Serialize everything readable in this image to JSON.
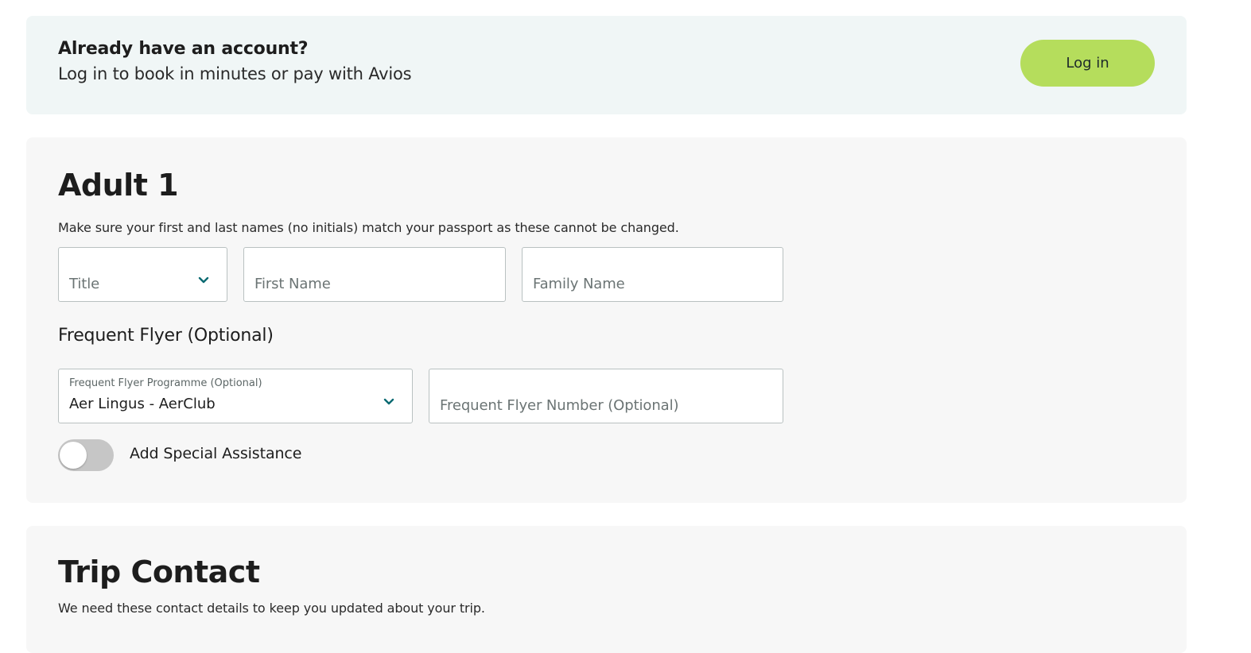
{
  "login_banner": {
    "heading": "Already have an account?",
    "subtext": "Log in to book in minutes or pay with Avios",
    "login_button": "Log in"
  },
  "adult": {
    "title": "Adult 1",
    "note": "Make sure your first and last names (no initials) match your passport as these cannot be changed.",
    "title_field": {
      "placeholder": "Title",
      "icon": "chevron-down-icon"
    },
    "first_name": {
      "placeholder": "First Name"
    },
    "family_name": {
      "placeholder": "Family Name"
    },
    "frequent_flyer": {
      "heading": "Frequent Flyer (Optional)",
      "programme": {
        "label": "Frequent Flyer Programme (Optional)",
        "value": "Aer Lingus - AerClub",
        "icon": "chevron-down-icon"
      },
      "number": {
        "placeholder": "Frequent Flyer Number (Optional)"
      }
    },
    "special_assistance": {
      "label": "Add Special Assistance",
      "enabled": false
    }
  },
  "trip_contact": {
    "title": "Trip Contact",
    "note": "We need these contact details to keep you updated about your trip."
  },
  "colors": {
    "accent_button": "#b5dd5c",
    "chevron": "#0b6a72",
    "banner_bg": "#f0f6f6",
    "card_bg": "#f7f7f7"
  }
}
